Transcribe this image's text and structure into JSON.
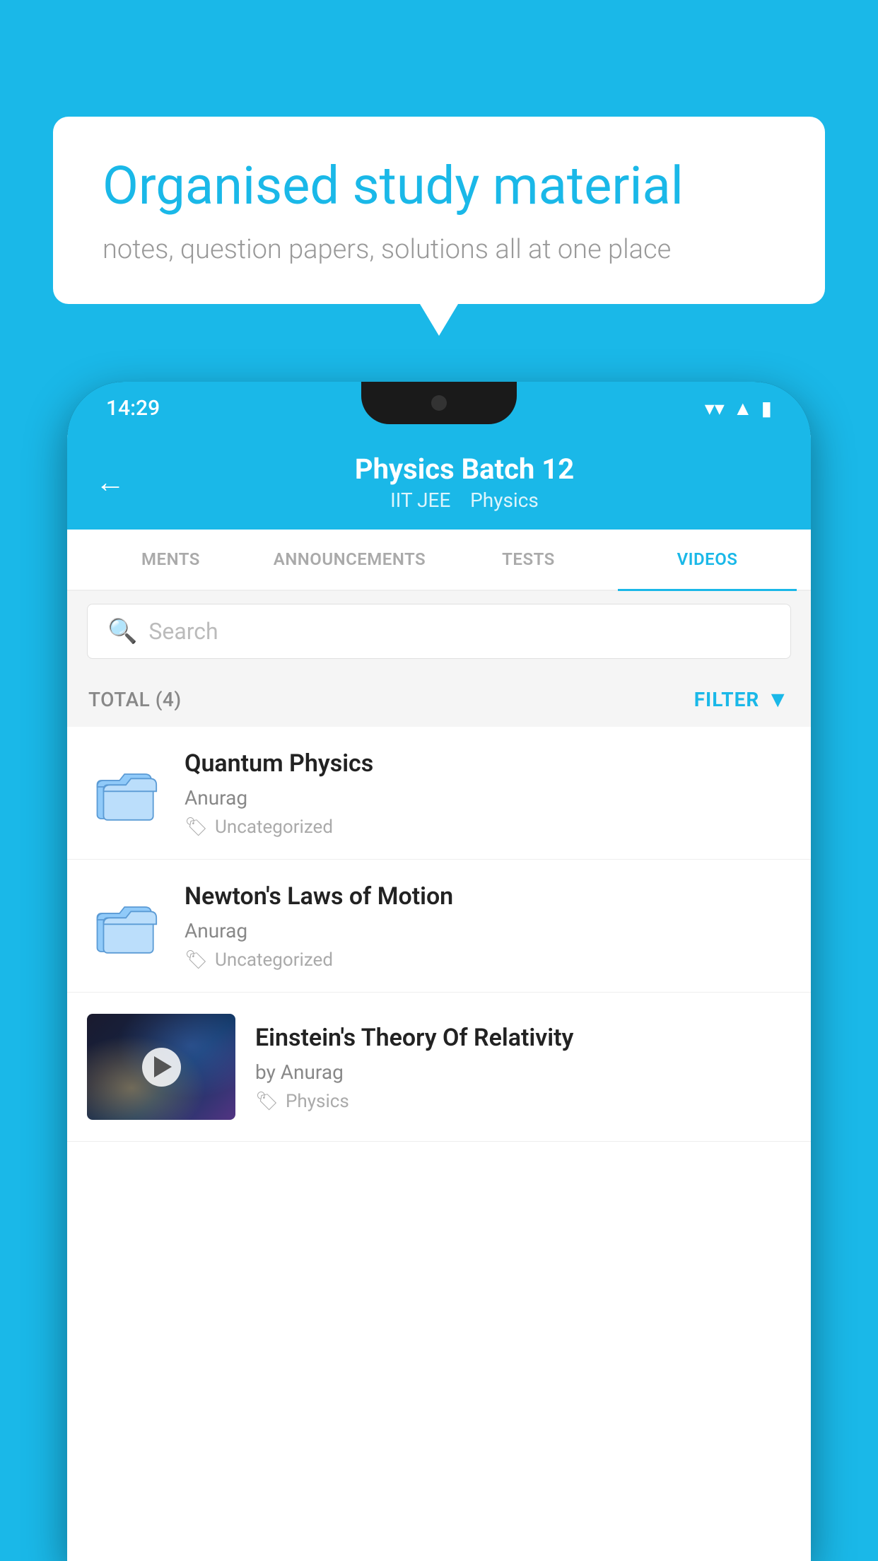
{
  "background_color": "#1ab8e8",
  "speech_bubble": {
    "title": "Organised study material",
    "subtitle": "notes, question papers, solutions all at one place"
  },
  "phone": {
    "status_bar": {
      "time": "14:29",
      "wifi": "▼",
      "signal": "▲",
      "battery": "▮"
    },
    "header": {
      "back_label": "←",
      "title": "Physics Batch 12",
      "subtitle_part1": "IIT JEE",
      "subtitle_part2": "Physics"
    },
    "tabs": [
      {
        "label": "MENTS",
        "active": false
      },
      {
        "label": "ANNOUNCEMENTS",
        "active": false
      },
      {
        "label": "TESTS",
        "active": false
      },
      {
        "label": "VIDEOS",
        "active": true
      }
    ],
    "search": {
      "placeholder": "Search"
    },
    "filter_bar": {
      "total_label": "TOTAL (4)",
      "filter_label": "FILTER"
    },
    "videos": [
      {
        "id": 1,
        "title": "Quantum Physics",
        "author": "Anurag",
        "tag": "Uncategorized",
        "has_thumbnail": false
      },
      {
        "id": 2,
        "title": "Newton's Laws of Motion",
        "author": "Anurag",
        "tag": "Uncategorized",
        "has_thumbnail": false
      },
      {
        "id": 3,
        "title": "Einstein's Theory Of Relativity",
        "author": "by Anurag",
        "tag": "Physics",
        "has_thumbnail": true
      }
    ]
  }
}
